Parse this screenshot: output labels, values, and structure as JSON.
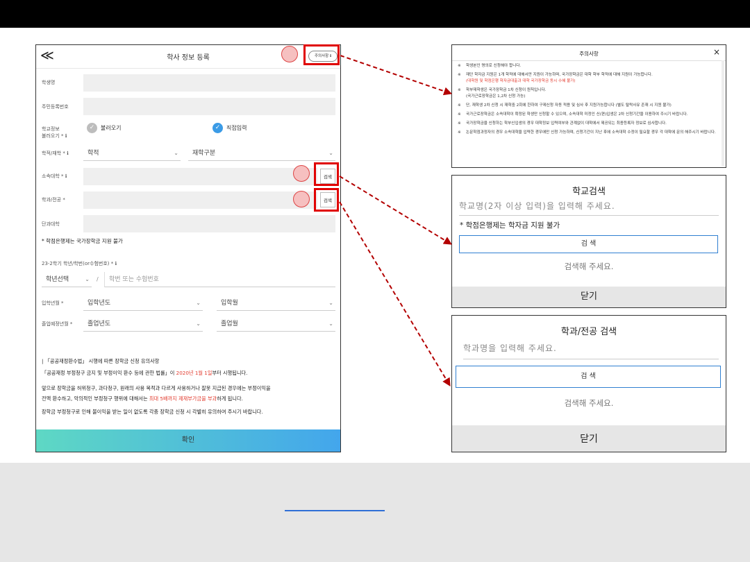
{
  "form": {
    "back": "≪",
    "title": "학사 정보 등록",
    "caution_button": "주의사항 ℹ",
    "student_name_label": "학생명",
    "rrn_label": "주민등록번호",
    "school_info_label": "학교정보\n불러오기 * ℹ",
    "option_load": "불러오기",
    "option_direct": "직접입력",
    "enroll_label": "학적/재학 * ℹ",
    "enroll_select": "학적",
    "enroll_type_select": "재학구분",
    "univ_label": "소속대학 * ℹ",
    "dept_label": "학과/전공 *",
    "college_label": "단과대학",
    "search_btn": "검색",
    "credit_bank_note": "* 학점은행제는 국가장학금 지원 불가",
    "grade_label": "23-2학기 학년/학번(or수험번호) * ℹ",
    "grade_select": "학년선택",
    "slash": "/",
    "student_no_placeholder": "학번 또는 수험번호",
    "admission_label": "입학년월 *",
    "admission_year": "입학년도",
    "admission_month": "입학월",
    "grad_label": "졸업예정년월 *",
    "grad_year": "졸업년도",
    "grad_month": "졸업월",
    "notice_title": "| 「공공재정환수법」 시행에 따른 장학금 신청 유의사항",
    "notice_p1a": "「공공재정 부정청구 금지 및 부정이익 환수 등에 관한 법률」이 ",
    "notice_p1b": "2020년 1월 1일",
    "notice_p1c": "부터 시행됩니다.",
    "notice_p2a": "앞으로 장학금을 허위청구, 과다청구, 원래의 사용 목적과 다르게 사용하거나 잘못 지급된 경우에는 부정이익을",
    "notice_p2b": "전액 환수하고, 악의적인 부정청구 행위에 대해서는 ",
    "notice_p2c": "최대 5배까지 제재부가금을 부과",
    "notice_p2d": "하게 됩니다.",
    "notice_p3": "장학금 부정청구로 인해 불이익을 받는 일이 없도록 각종 장학금 신청 시 각별히 유의하여 주시기 바랍니다.",
    "confirm": "확인"
  },
  "caution": {
    "title": "주의사항",
    "close": "×",
    "marker": "※",
    "items": [
      {
        "text": "학생본인 명의로 신청해야 합니다.",
        "sub": ""
      },
      {
        "text": "재단 학자금 지원은 1개 학적에 대해서만 지원이 가능하며, 국가장학금은 대학 학부 학적에 대해 지원이 가능합니다.",
        "sub": "(대학원 및 학점은행 학자금대출과 대학 국가장학금 동시 수혜 불가)"
      },
      {
        "text": "학부재학생은 국가장학금 1차 신청이 원칙입니다.",
        "sub": "(국가근로장학금은 1,2차 신청 가능)"
      },
      {
        "text": "단, 재학생 2차 신청 시 재학중 2회에 한하여 구제신청 자동 적용 및 심사 후 지원가능합니다 (별도 탈락사유 존재 시 지원 불가)",
        "sub": ""
      },
      {
        "text": "국가근로장학금은 소속대학이 확정된 학생만 신청할 수 있으며, 소속대학 미정인 신(편)입생은 2차 신청기간을 이용하여 주시기 바랍니다.",
        "sub": ""
      },
      {
        "text": "국가장학금을 신청하는 학부신입생의 경우 대학정보 입력여부와 관계없이 대학에서 제공되는 최종등록자 정보로 심사합니다.",
        "sub": ""
      },
      {
        "text": "논문학점과정자의 경우 소속대학을 입력한 경우에만 신청 가능하며, 신청기간이 지난 후에 소속대학 수정이 필요할 경우 각 대학에 문의 해주시기 바랍니다.",
        "sub": ""
      }
    ]
  },
  "school_search": {
    "title": "학교검색",
    "placeholder": "학교명(2자 이상 입력)을 입력해 주세요.",
    "note": "* 학점은행제는 학자금 지원 불가",
    "button": "검 색",
    "message": "검색해 주세요.",
    "close": "닫기"
  },
  "dept_search": {
    "title": "학과/전공 검색",
    "placeholder": "학과명을 입력해 주세요.",
    "button": "검 색",
    "message": "검색해 주세요.",
    "close": "닫기"
  },
  "colors": {
    "highlight": "#e00000",
    "accent_red": "#e23b2e",
    "accent_blue": "#2f7fd1",
    "radio_checked": "#3b9be6",
    "radio_unchecked": "#bdbdbd",
    "confirm_gradient": [
      "#5ed8c4",
      "#43a6ec"
    ]
  }
}
